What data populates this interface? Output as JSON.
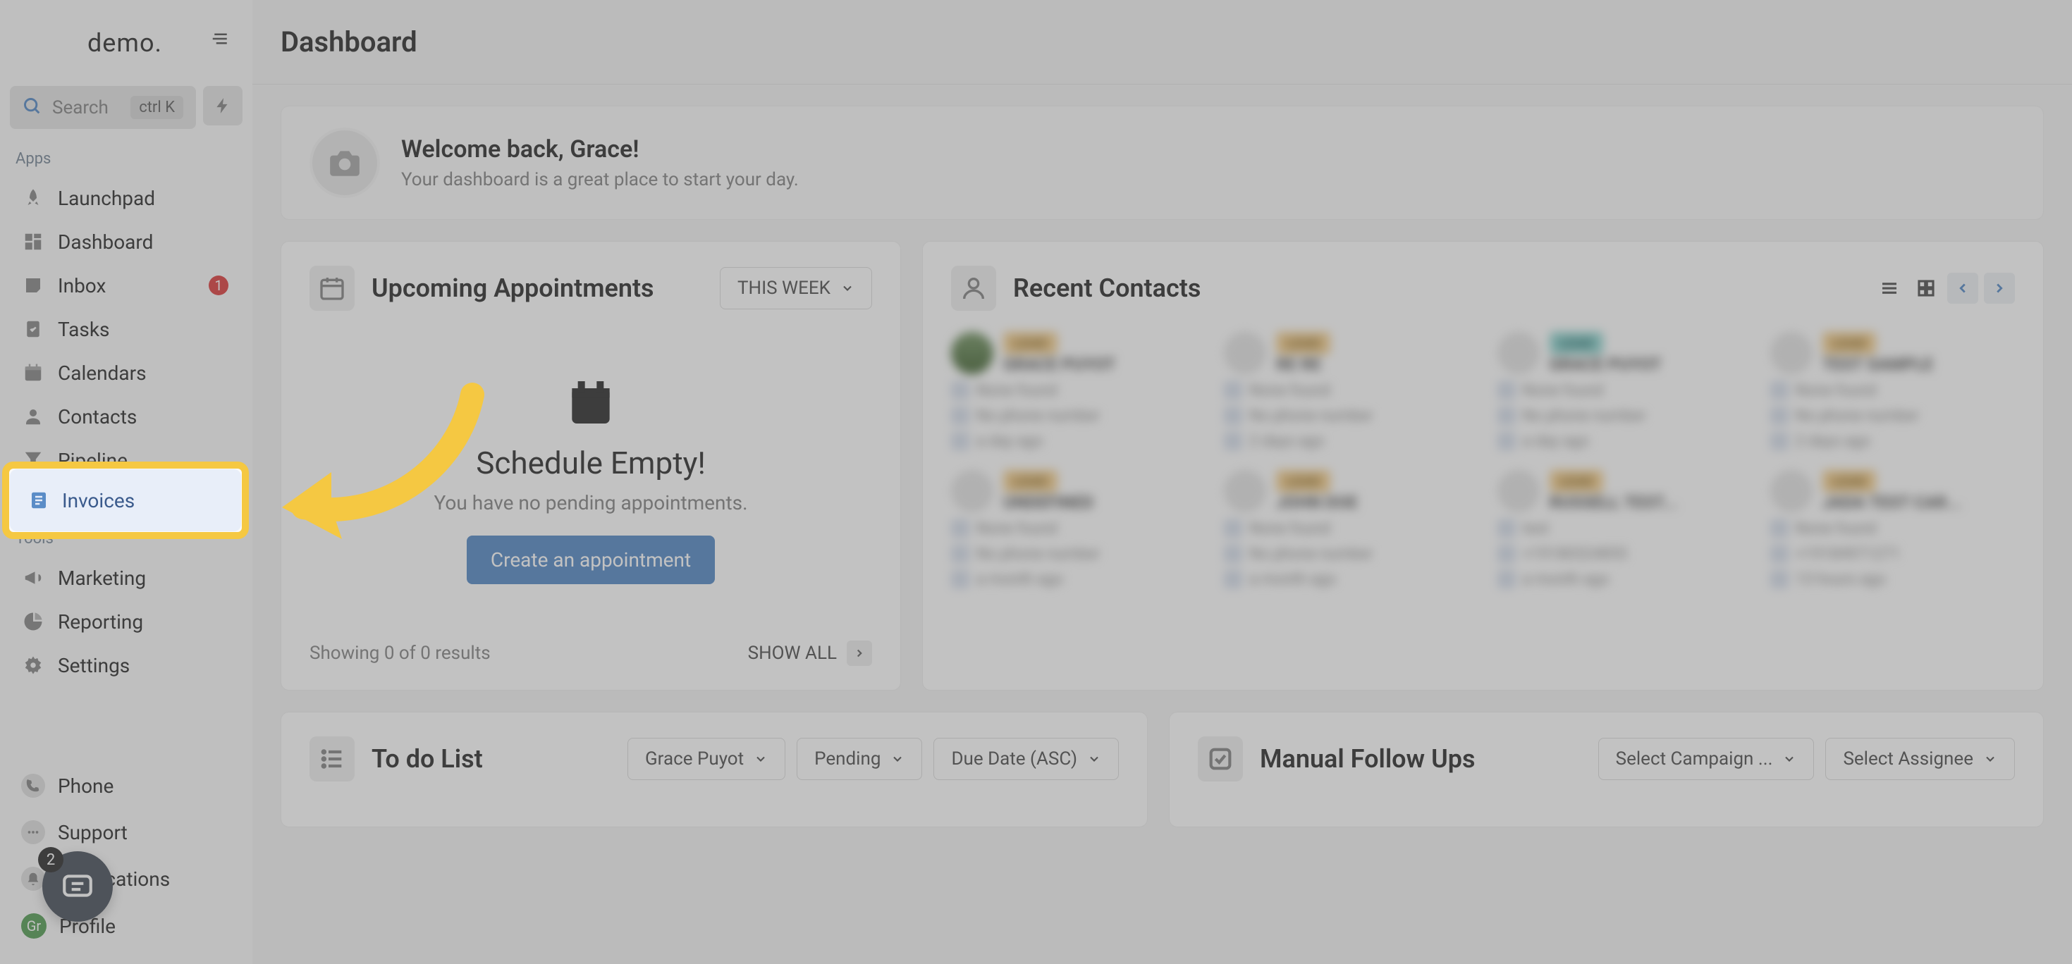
{
  "logo": "demo.",
  "search": {
    "label": "Search",
    "shortcut": "ctrl K"
  },
  "sections": {
    "apps": "Apps",
    "tools": "Tools"
  },
  "nav": {
    "launchpad": "Launchpad",
    "dashboard": "Dashboard",
    "inbox": "Inbox",
    "inbox_badge": "1",
    "tasks": "Tasks",
    "calendars": "Calendars",
    "contacts": "Contacts",
    "pipeline": "Pipeline",
    "invoices": "Invoices",
    "marketing": "Marketing",
    "reporting": "Reporting",
    "settings": "Settings",
    "phone": "Phone",
    "support": "Support",
    "notifications": "Notifications",
    "profile": "Profile",
    "profile_initials": "Gr"
  },
  "chat_badge": "2",
  "header": {
    "title": "Dashboard"
  },
  "welcome": {
    "title": "Welcome back, Grace!",
    "subtitle": "Your dashboard is a great place to start your day."
  },
  "appointments": {
    "title": "Upcoming Appointments",
    "filter": "THIS WEEK",
    "empty_title": "Schedule Empty!",
    "empty_subtitle": "You have no pending appointments.",
    "cta": "Create an appointment",
    "results": "Showing 0 of 0 results",
    "show_all": "SHOW ALL"
  },
  "contacts": {
    "title": "Recent Contacts",
    "cards": [
      {
        "tag": "LEAD",
        "name": "GRACE PUYOT",
        "l1": "None found",
        "l2": "No phone number",
        "l3": "a day ago"
      },
      {
        "tag": "LEAD",
        "name": "RE RE",
        "l1": "None found",
        "l2": "No phone number",
        "l3": "2 days ago"
      },
      {
        "tag": "LEAD",
        "name": "GRACE PUYOT",
        "l1": "None found",
        "l2": "No phone number",
        "l3": "a day ago"
      },
      {
        "tag": "LEAD",
        "name": "TEST SAMPLE",
        "l1": "None found",
        "l2": "No phone number",
        "l3": "2 days ago"
      },
      {
        "tag": "LEAD",
        "name": "UNDEFINED",
        "l1": "None found",
        "l2": "No phone number",
        "l3": "a month ago"
      },
      {
        "tag": "LEAD",
        "name": "JOHN DOE",
        "l1": "None found",
        "l2": "No phone number",
        "l3": "a month ago"
      },
      {
        "tag": "LEAD",
        "name": "RUSSELL TEST...",
        "l1": "test",
        "l2": "+19180324855",
        "l3": "a month ago"
      },
      {
        "tag": "LEAD",
        "name": "JADA TEST CAR...",
        "l1": "None found",
        "l2": "+19184971271",
        "l3": "13 hours ago"
      }
    ]
  },
  "todo": {
    "title": "To do List",
    "filter_user": "Grace Puyot",
    "filter_status": "Pending",
    "filter_sort": "Due Date (ASC)"
  },
  "followups": {
    "title": "Manual Follow Ups",
    "filter_campaign": "Select Campaign ...",
    "filter_assignee": "Select Assignee"
  }
}
